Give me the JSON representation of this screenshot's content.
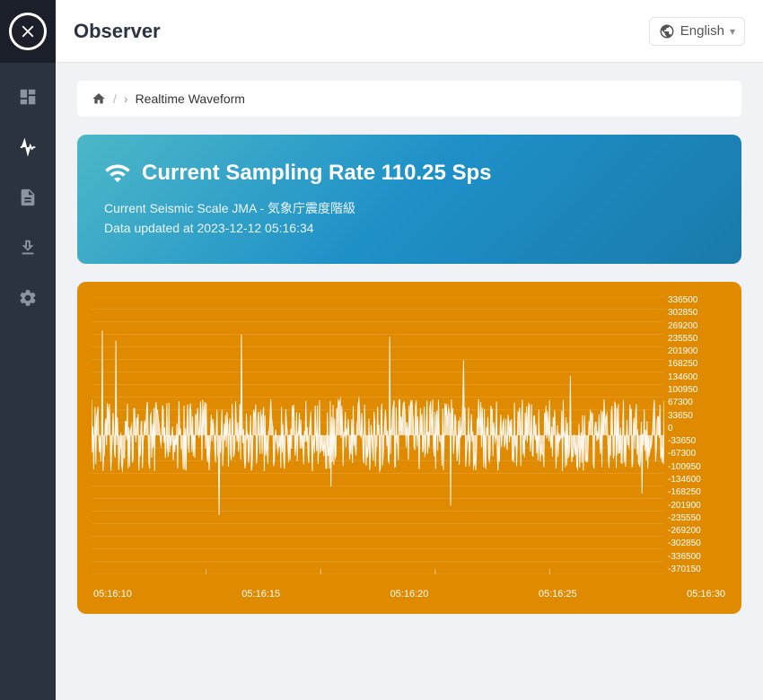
{
  "app": {
    "title": "Observer",
    "logo_symbol": "✕"
  },
  "language": {
    "current": "English",
    "dropdown_icon": "▾"
  },
  "breadcrumb": {
    "home_icon": "home",
    "separator": "/",
    "chevron": "›",
    "current": "Realtime Waveform"
  },
  "info_card": {
    "sampling_rate_label": "Current Sampling Rate",
    "sampling_rate_value": "110.25 Sps",
    "seismic_scale_label": "Current Seismic Scale JMA - 気象庁震度階級",
    "data_updated_label": "Data updated at 2023-12-12 05:16:34"
  },
  "waveform": {
    "y_axis_labels": [
      "336500",
      "302850",
      "269200",
      "235550",
      "201900",
      "168250",
      "134600",
      "100950",
      "67300",
      "33650",
      "0",
      "-33650",
      "-67300",
      "-100950",
      "-134600",
      "-168250",
      "-201900",
      "-235550",
      "-269200",
      "-302850",
      "-336500",
      "-370150"
    ],
    "x_axis_labels": [
      "05:16:10",
      "05:16:15",
      "05:16:20",
      "05:16:25",
      "05:16:30"
    ],
    "background_color": "#e08a00"
  },
  "sidebar": {
    "items": [
      {
        "name": "dashboard",
        "icon": "dashboard"
      },
      {
        "name": "waveform",
        "icon": "waveform"
      },
      {
        "name": "report",
        "icon": "report"
      },
      {
        "name": "download",
        "icon": "download"
      },
      {
        "name": "settings",
        "icon": "settings"
      }
    ]
  }
}
